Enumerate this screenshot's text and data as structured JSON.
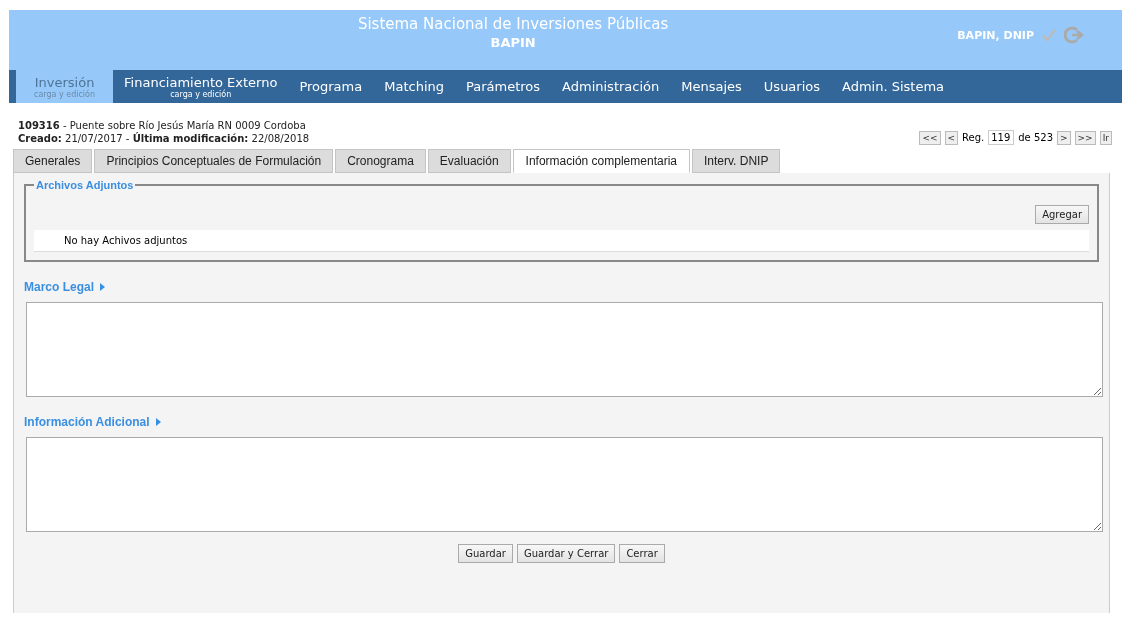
{
  "header": {
    "title": "Sistema Nacional de Inversiones Públicas",
    "subtitle": "BAPIN",
    "user": "BAPIN, DNIP"
  },
  "nav": [
    {
      "label": "Inversión",
      "subtitle": "carga y edición",
      "selected": true
    },
    {
      "label": "Financiamiento Externo",
      "subtitle": "carga y edición",
      "selected": false
    },
    {
      "label": "Programa",
      "selected": false
    },
    {
      "label": "Matching",
      "selected": false
    },
    {
      "label": "Parámetros",
      "selected": false
    },
    {
      "label": "Administración",
      "selected": false
    },
    {
      "label": "Mensajes",
      "selected": false
    },
    {
      "label": "Usuarios",
      "selected": false
    },
    {
      "label": "Admin. Sistema",
      "selected": false
    }
  ],
  "record": {
    "id": "109316",
    "separator": "-",
    "name": "Puente sobre Río Jesús María RN 0009 Cordoba",
    "created_label": "Creado:",
    "created": "21/07/2017 -",
    "modified_label": "Última modificación:",
    "modified": "22/08/2018"
  },
  "pager": {
    "first": "<<",
    "prev": "<",
    "reg_label": "Reg.",
    "value": "119",
    "total": "de 523",
    "next": ">",
    "last": ">>",
    "go": "Ir"
  },
  "tabs": [
    {
      "label": "Generales",
      "selected": false
    },
    {
      "label": "Principios Conceptuales de Formulación",
      "selected": false
    },
    {
      "label": "Cronograma",
      "selected": false
    },
    {
      "label": "Evaluación",
      "selected": false
    },
    {
      "label": "Información complementaria",
      "selected": true
    },
    {
      "label": "Interv. DNIP",
      "selected": false
    }
  ],
  "attachments": {
    "legend": "Archivos Adjuntos",
    "add_button": "Agregar",
    "empty_text": "No hay Achivos adjuntos"
  },
  "sections": [
    {
      "label": "Marco Legal"
    },
    {
      "label": "Información Adicional"
    }
  ],
  "buttons": [
    "Guardar",
    "Guardar y Cerrar",
    "Cerrar"
  ]
}
